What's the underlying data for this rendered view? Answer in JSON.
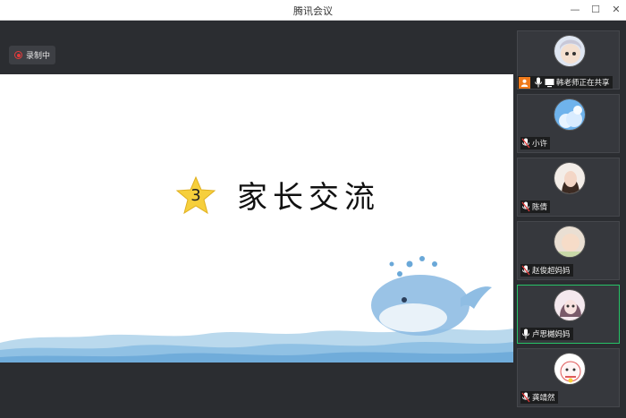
{
  "window": {
    "title": "腾讯会议",
    "minimize": "—",
    "maximize": "☐",
    "close": "✕"
  },
  "toolbar": {
    "record_label": "录制中"
  },
  "slide": {
    "number": "3",
    "title": "家长交流"
  },
  "participants": [
    {
      "name": "韩老师正在共享",
      "avatar": "anime-avatar",
      "host": true,
      "sharing": true,
      "speaking": false
    },
    {
      "name": "小许",
      "avatar": "sky-avatar",
      "host": false,
      "sharing": false,
      "speaking": false
    },
    {
      "name": "陈倩",
      "avatar": "girl-avatar",
      "host": false,
      "sharing": false,
      "speaking": false
    },
    {
      "name": "赵俊超妈妈",
      "avatar": "baby-avatar",
      "host": false,
      "sharing": false,
      "speaking": false
    },
    {
      "name": "卢思樾妈妈",
      "avatar": "doll-avatar",
      "host": false,
      "sharing": false,
      "speaking": true
    },
    {
      "name": "龚靖然",
      "avatar": "lucky-cat-avatar",
      "host": false,
      "sharing": false,
      "speaking": false
    }
  ],
  "colors": {
    "active_border": "#27c267",
    "host_badge": "#f07a1a",
    "record_dot": "#e53b3b",
    "star": "#f6cf3c"
  }
}
